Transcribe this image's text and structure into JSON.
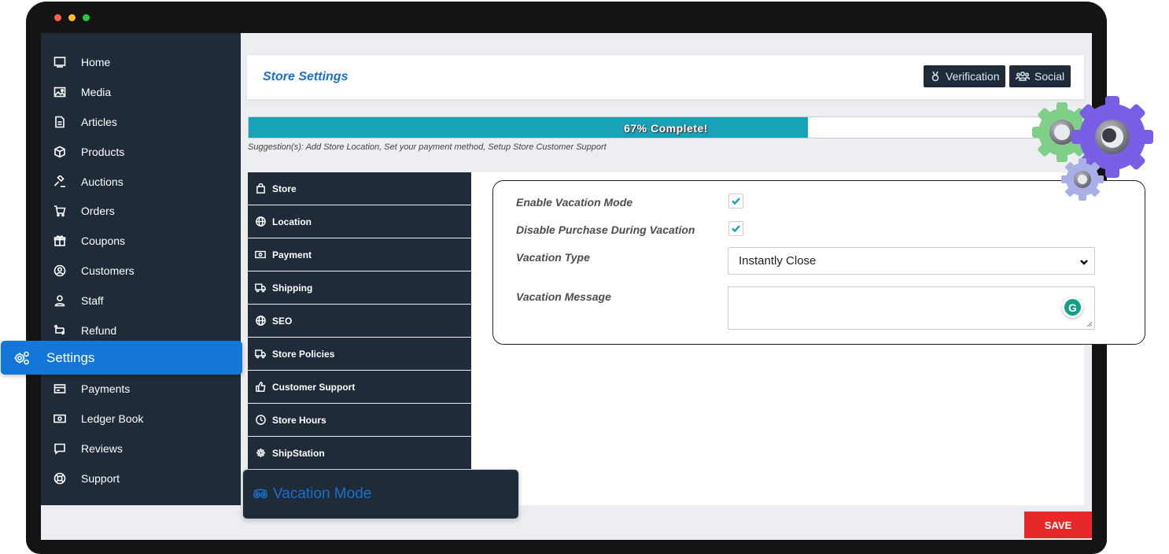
{
  "window": {
    "dot_colors": [
      "#ff5f57",
      "#febc2e",
      "#28c840"
    ]
  },
  "sidebar": {
    "items": [
      {
        "label": "Home",
        "icon": "monitor-icon"
      },
      {
        "label": "Media",
        "icon": "image-icon"
      },
      {
        "label": "Articles",
        "icon": "document-icon"
      },
      {
        "label": "Products",
        "icon": "cube-icon"
      },
      {
        "label": "Auctions",
        "icon": "gavel-icon"
      },
      {
        "label": "Orders",
        "icon": "cart-icon"
      },
      {
        "label": "Coupons",
        "icon": "gift-icon"
      },
      {
        "label": "Customers",
        "icon": "user-circle-icon"
      },
      {
        "label": "Staff",
        "icon": "user-icon"
      },
      {
        "label": "Refund",
        "icon": "refund-icon"
      },
      {
        "label": "Payments",
        "icon": "credit-card-icon"
      },
      {
        "label": "Ledger Book",
        "icon": "money-icon"
      },
      {
        "label": "Reviews",
        "icon": "comment-icon"
      },
      {
        "label": "Support",
        "icon": "lifebuoy-icon"
      }
    ],
    "active": {
      "label": "Settings",
      "icon": "gears-icon"
    }
  },
  "header": {
    "title": "Store Settings",
    "buttons": [
      {
        "label": "Verification",
        "icon": "medal-icon"
      },
      {
        "label": "Social",
        "icon": "users-icon"
      }
    ]
  },
  "progress": {
    "percent": 67,
    "label": "67% Complete!",
    "suggestion": "Suggestion(s): Add Store Location, Set your payment method, Setup Store Customer Support"
  },
  "tabs": [
    {
      "label": "Store",
      "icon": "bag-icon"
    },
    {
      "label": "Location",
      "icon": "globe-icon"
    },
    {
      "label": "Payment",
      "icon": "money-icon"
    },
    {
      "label": "Shipping",
      "icon": "truck-icon"
    },
    {
      "label": "SEO",
      "icon": "globe-icon"
    },
    {
      "label": "Store Policies",
      "icon": "truck-icon"
    },
    {
      "label": "Customer Support",
      "icon": "thumbs-up-icon"
    },
    {
      "label": "Store Hours",
      "icon": "clock-icon"
    },
    {
      "label": "ShipStation",
      "icon": "gear-icon"
    }
  ],
  "active_tab": {
    "label": "Vacation Mode",
    "icon": "tripadvisor-icon"
  },
  "form": {
    "enable_label": "Enable Vacation Mode",
    "enable_checked": true,
    "disable_label": "Disable Purchase During Vacation",
    "disable_checked": true,
    "type_label": "Vacation Type",
    "type_value": "Instantly Close",
    "message_label": "Vacation Message",
    "message_value": "",
    "grammarly_letter": "G"
  },
  "actions": {
    "save_label": "SAVE"
  },
  "colors": {
    "sidebar_bg": "#1f2b38",
    "accent_blue": "#1476d9",
    "progress_fill": "#17a2b8",
    "save_red": "#e62828"
  }
}
